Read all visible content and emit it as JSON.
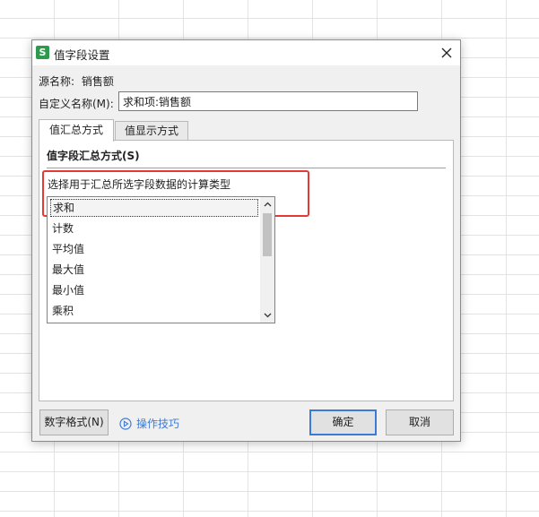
{
  "dialog": {
    "title": "值字段设置",
    "app_icon_letter": "S",
    "source_label": "源名称:",
    "source_value": "销售额",
    "custom_name_label": "自定义名称(M):",
    "custom_name_value": "求和项:销售额",
    "tabs": [
      {
        "label": "值汇总方式",
        "active": true
      },
      {
        "label": "值显示方式",
        "active": false
      }
    ],
    "section_title": "值字段汇总方式(S)",
    "instruction": "选择用于汇总所选字段数据的计算类型",
    "list_items": [
      "求和",
      "计数",
      "平均值",
      "最大值",
      "最小值",
      "乘积"
    ],
    "selected_item": "求和",
    "buttons": {
      "number_format": "数字格式(N)",
      "tips": "操作技巧",
      "ok": "确定",
      "cancel": "取消"
    }
  },
  "colors": {
    "highlight_box": "#e53935",
    "link": "#3d7bd6",
    "app_icon": "#2e9a4e",
    "default_button_border": "#3a7bd5"
  }
}
